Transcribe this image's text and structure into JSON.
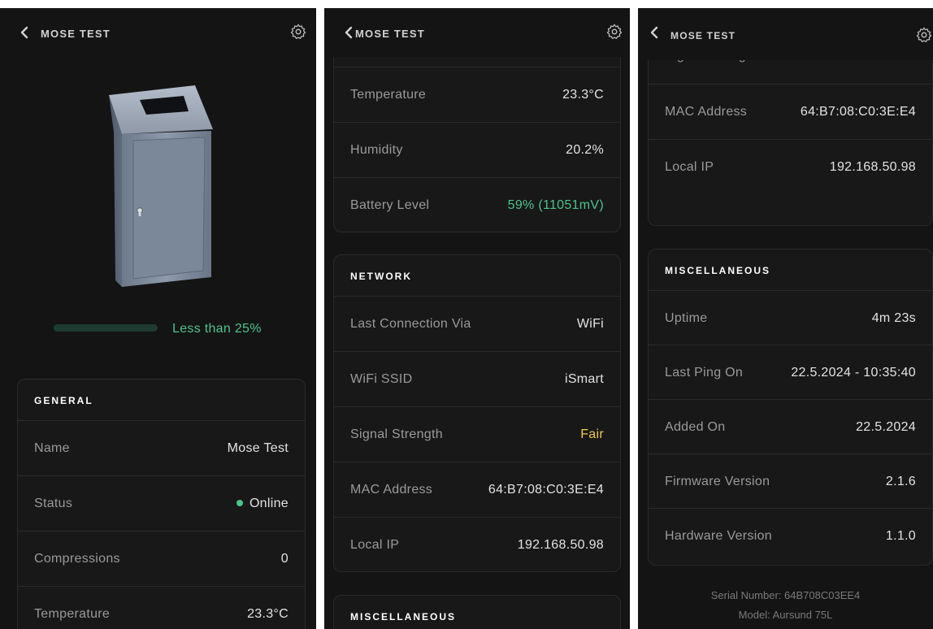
{
  "header": {
    "title": "MOSE TEST"
  },
  "fill": {
    "bar_fraction": 0.25,
    "label": "Less than 25%"
  },
  "general": {
    "title": "GENERAL",
    "rows": [
      {
        "label": "Name",
        "value": "Mose Test"
      },
      {
        "label": "Status",
        "value": "Online"
      },
      {
        "label": "Compressions",
        "value": "0"
      },
      {
        "label": "Temperature",
        "value": "23.3°C"
      }
    ]
  },
  "sensors": {
    "rows": [
      {
        "label": "Temperature",
        "value": "23.3°C"
      },
      {
        "label": "Humidity",
        "value": "20.2%"
      },
      {
        "label": "Battery Level",
        "value": "59% (11051mV)"
      }
    ]
  },
  "network": {
    "title": "NETWORK",
    "rows": [
      {
        "label": "Last Connection Via",
        "value": "WiFi"
      },
      {
        "label": "WiFi SSID",
        "value": "iSmart"
      },
      {
        "label": "Signal Strength",
        "value": "Fair"
      },
      {
        "label": "MAC Address",
        "value": "64:B7:08:C0:3E:E4"
      },
      {
        "label": "Local IP",
        "value": "192.168.50.98"
      }
    ]
  },
  "misc": {
    "title": "MISCELLANEOUS",
    "rows": [
      {
        "label": "Uptime",
        "value": "4m 23s"
      },
      {
        "label": "Last Ping On",
        "value": "22.5.2024 - 10:35:40"
      },
      {
        "label": "Added On",
        "value": "22.5.2024"
      },
      {
        "label": "Firmware Version",
        "value": "2.1.6"
      },
      {
        "label": "Hardware Version",
        "value": "1.1.0"
      }
    ]
  },
  "footer": {
    "serial": "Serial Number: 64B708C03EE4",
    "model": "Model: Aursund 75L"
  },
  "colors": {
    "background": "#141414",
    "good": "#4cc38a",
    "warn": "#f2cc4a",
    "bar_track": "#1f3b30"
  },
  "icons": {
    "back": "chevron-left-icon",
    "settings": "gear-icon"
  }
}
